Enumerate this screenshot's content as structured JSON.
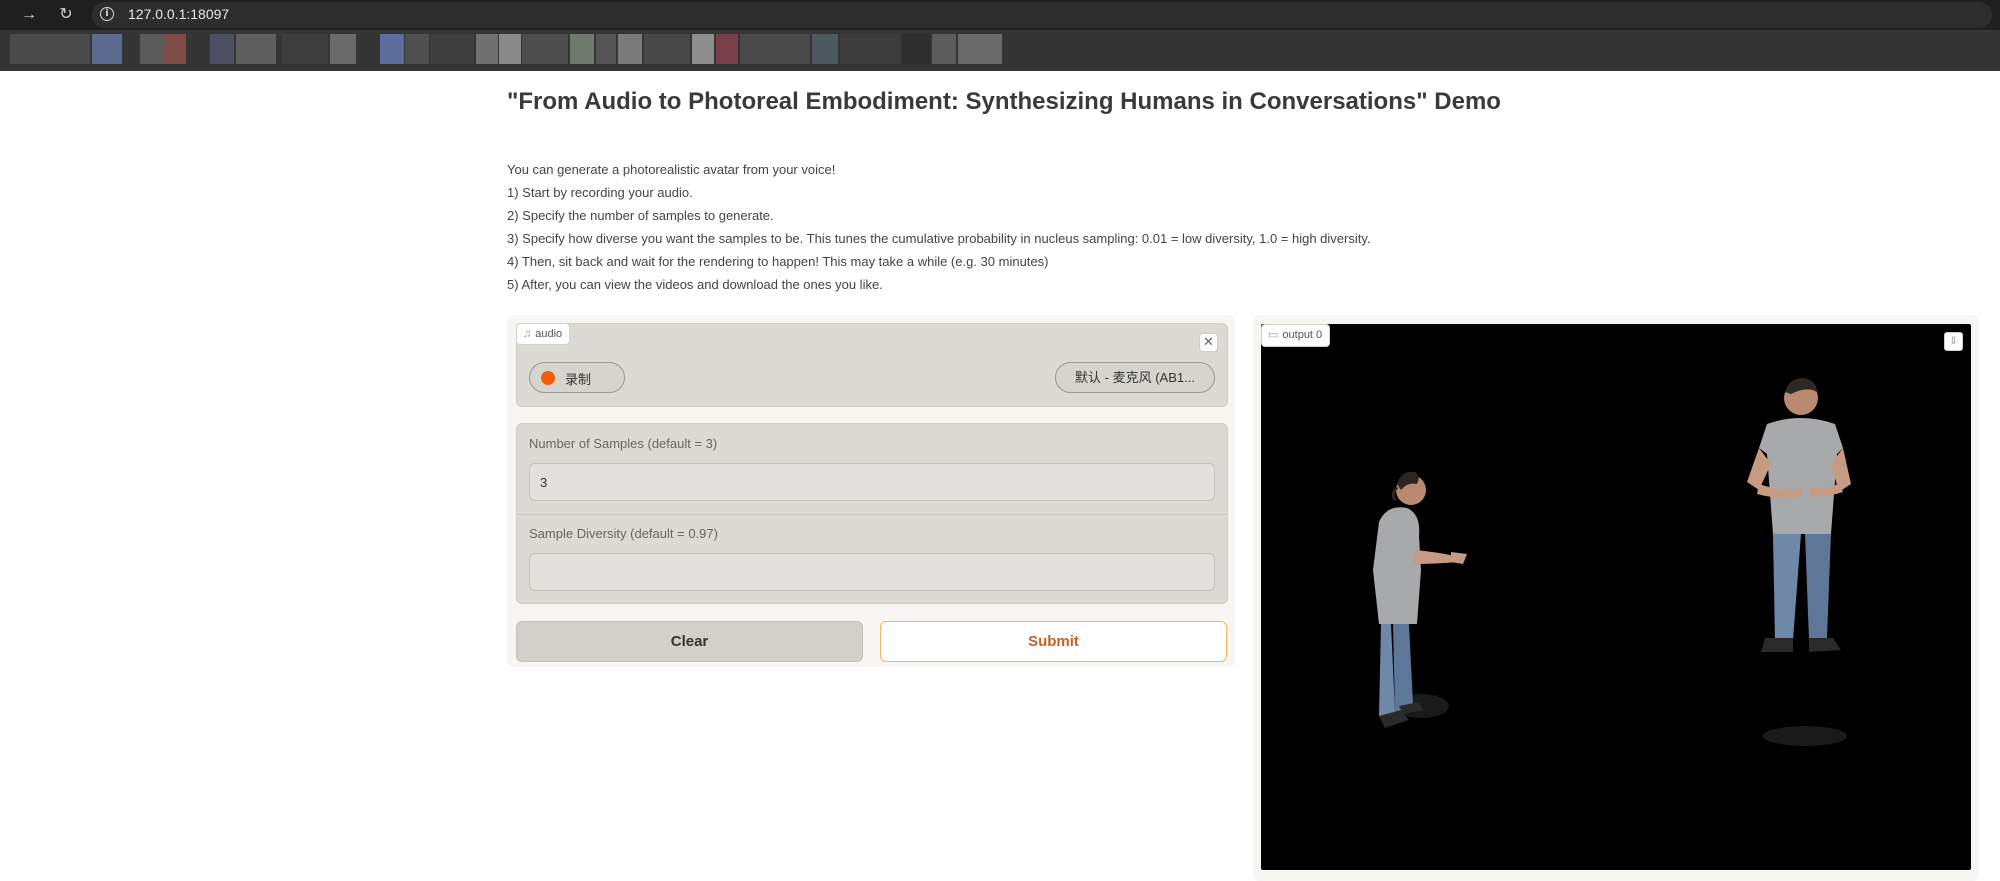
{
  "browser": {
    "url": "127.0.0.1:18097",
    "icons": {
      "forward": "arrow-right-icon",
      "reload": "reload-icon",
      "info": "info-icon"
    }
  },
  "page": {
    "title": "\"From Audio to Photoreal Embodiment: Synthesizing Humans in Conversations\" Demo",
    "description": [
      "You can generate a photorealistic avatar from your voice!",
      "1) Start by recording your audio.",
      "2) Specify the number of samples to generate.",
      "3) Specify how diverse you want the samples to be. This tunes the cumulative probability in nucleus sampling: 0.01 = low diversity, 1.0 = high diversity.",
      "4) Then, sit back and wait for the rendering to happen! This may take a while (e.g. 30 minutes)",
      "5) After, you can view the videos and download the ones you like."
    ]
  },
  "audio": {
    "label": "audio",
    "record_label": "录制",
    "mic_selected": "默认 - 麦克风 (AB1...",
    "icon": "music-note-icon",
    "close_icon": "close-icon"
  },
  "form": {
    "num_samples": {
      "label": "Number of Samples (default = 3)",
      "value": "3"
    },
    "diversity": {
      "label": "Sample Diversity (default = 0.97)",
      "value": ""
    }
  },
  "buttons": {
    "clear": "Clear",
    "submit": "Submit"
  },
  "output": {
    "label": "output 0",
    "icon": "video-icon",
    "download_icon": "download-icon"
  },
  "colors": {
    "record_dot": "#f25c05",
    "submit_border": "#f5b567",
    "submit_text": "#c2622a",
    "panel_bg": "#dcdad5",
    "video_bg": "#000000"
  }
}
